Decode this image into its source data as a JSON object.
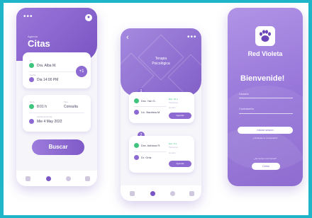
{
  "screen1": {
    "menu_dots": "•••",
    "avatar_glyph": "●",
    "subtitle": "Agenda",
    "title": "Citas",
    "card1": {
      "label_doctor": "Dr.",
      "doctor": "Dra. Alba M.",
      "label_date": "Fecha",
      "date": "Dia 14:00 PM",
      "badge": "+1"
    },
    "card2": {
      "label_time": "Hora",
      "time": "8:01 h",
      "label_type": "Tipo",
      "type": "Consulta",
      "label_date": "Fecha de la cita",
      "date": "Mie 4 May 2022"
    },
    "search_button": "Buscar"
  },
  "screen2": {
    "back_glyph": "‹",
    "menu_dots": "•••",
    "header_title_1": "Terapia",
    "header_title_2": "Psicológica",
    "group1": {
      "badge": "1",
      "row1_name": "Dra. Yan G.",
      "row2_name": "Lic. Bautista M.",
      "stat1": "Exp. 10 a",
      "stat2": "Pacientes",
      "stat3": "Horario",
      "button": "Agendar"
    },
    "group2": {
      "badge": "2",
      "row1_name": "Dra. Adriana R.",
      "row2_name": "Dr. Ortiz",
      "stat1": "Exp. 8 a",
      "stat2": "Pacientes",
      "stat3": "Horario",
      "button": "Agendar"
    }
  },
  "screen3": {
    "brand": "Red Violeta",
    "welcome": "Bienvenide!",
    "label_user": "Usuario",
    "label_password": "Contraseña",
    "login_button": "Iniciar sesión",
    "forgot": "¿Olvidaste tu contraseña?",
    "register_prompt": "¿No tienes una cuenta?",
    "register_button": "Crear"
  },
  "colors": {
    "accent": "#7a55c4",
    "accent_light": "#9c7cdb",
    "success": "#3fc47e",
    "frame": "#1fb5c8"
  },
  "icons": {
    "tab1": "home-icon",
    "tab2": "calendar-icon",
    "tab3": "settings-icon",
    "tab4": "user-icon",
    "logo": "paw-icon"
  }
}
